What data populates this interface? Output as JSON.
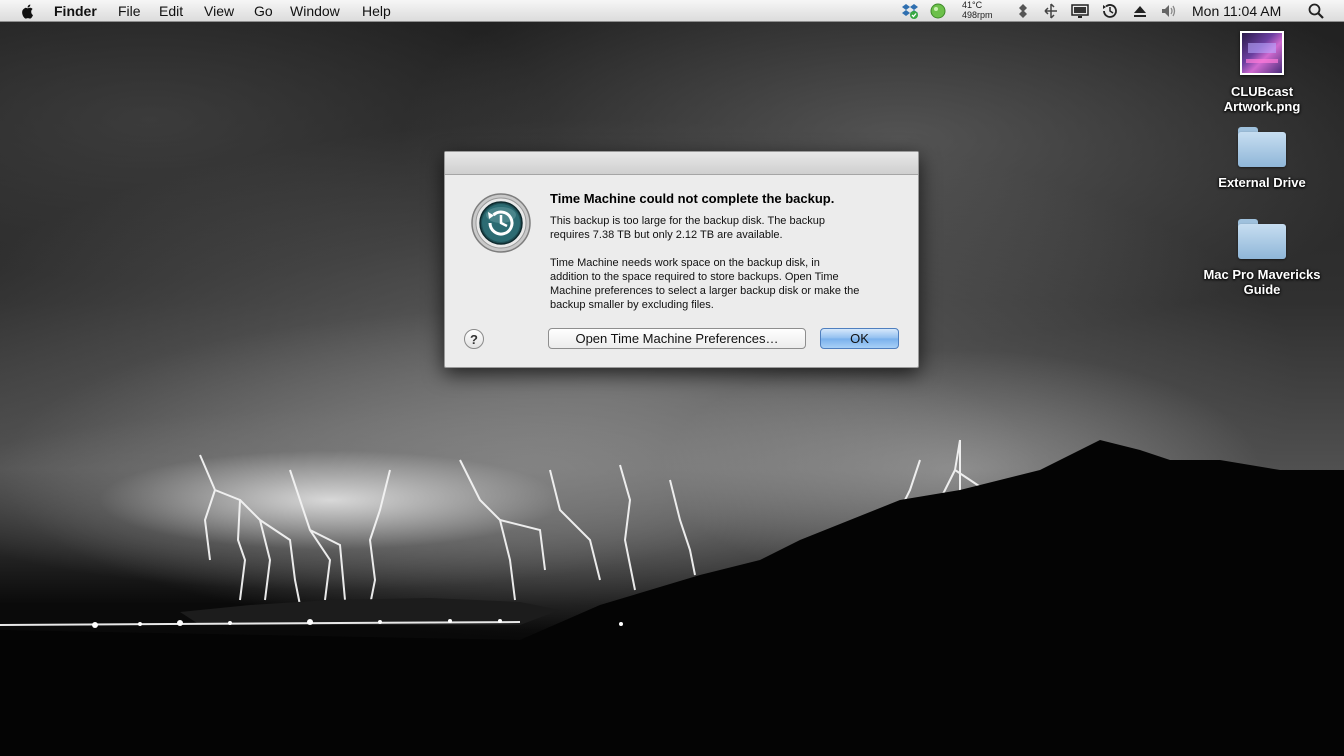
{
  "menubar": {
    "apple_icon": "apple-icon",
    "app_name": "Finder",
    "menus": [
      "File",
      "Edit",
      "View",
      "Go",
      "Window",
      "Help"
    ],
    "weather": {
      "temperature": "41°C",
      "fan_speed": "498rpm"
    },
    "clock": "Mon 11:04 AM",
    "status_icons": [
      "dropbox-icon",
      "status-green-icon",
      "network-icon",
      "bluetooth-icon",
      "display-icon",
      "time-machine-icon",
      "eject-icon",
      "volume-icon",
      "spotlight-icon"
    ]
  },
  "desktop": {
    "icons": [
      {
        "label": "CLUBcast Artwork.png",
        "label_line1": "CLUBcast",
        "label_line2": "Artwork.png",
        "kind": "image-thumbnail"
      },
      {
        "label": "External Drive",
        "label_line1": "External Drive",
        "label_line2": "",
        "kind": "folder"
      },
      {
        "label": "Mac Pro Mavericks Guide",
        "label_line1": "Mac Pro Mavericks",
        "label_line2": "Guide",
        "kind": "folder"
      }
    ]
  },
  "dialog": {
    "icon": "time-machine-icon",
    "title": "Time Machine could not complete the backup.",
    "message_1_line1": "This backup is too large for the backup disk. The backup",
    "message_1_line2": "requires 7.38 TB but only 2.12 TB are available.",
    "message_2_line1": "Time Machine needs work space on the backup disk, in",
    "message_2_line2": "addition to the space required to store backups. Open Time",
    "message_2_line3": "Machine preferences to select a larger backup disk or make the",
    "message_2_line4": "backup smaller by excluding files.",
    "help_label": "?",
    "secondary_button": "Open Time Machine Preferences…",
    "primary_button": "OK",
    "colors": {
      "default_button": "#8fbef0",
      "dialog_bg": "#ececec"
    }
  }
}
